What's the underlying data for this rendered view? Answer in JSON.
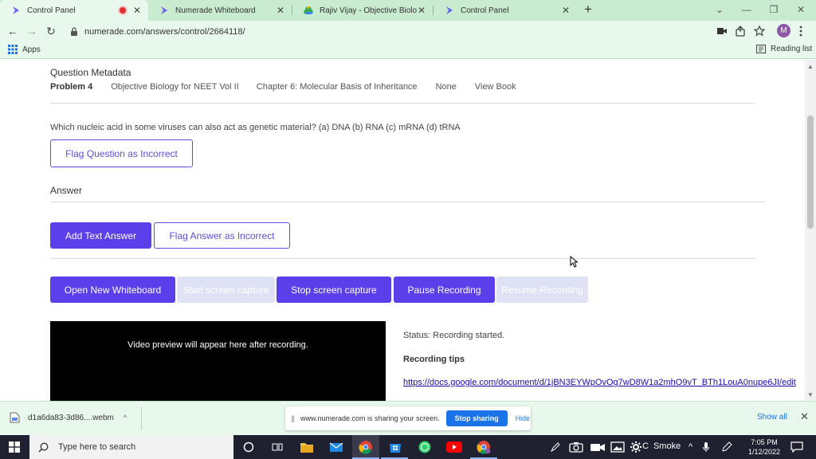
{
  "tabs": [
    {
      "title": "Control Panel",
      "recording": true,
      "active": true
    },
    {
      "title": "Numerade Whiteboard",
      "active": false
    },
    {
      "title": "Rajiv Vijay - Objective Biology fo",
      "active": false
    },
    {
      "title": "Control Panel",
      "active": false
    }
  ],
  "toolbar": {
    "url": "numerade.com/answers/control/2664118/",
    "avatar_letter": "M"
  },
  "bookmarks": {
    "apps_label": "Apps",
    "reading_list_label": "Reading list"
  },
  "page": {
    "metadata_title": "Question Metadata",
    "problem": "Problem 4",
    "book": "Objective Biology for NEET Vol II",
    "chapter": "Chapter 6: Molecular Basis of Inheritance",
    "section": "None",
    "view_book": "View Book",
    "question": "Which nucleic acid in some viruses can also act as genetic material? (a) DNA (b) RNA (c) mRNA (d) tRNA",
    "flag_question": "Flag Question as Incorrect",
    "answer_title": "Answer",
    "add_text_answer": "Add Text Answer",
    "flag_answer": "Flag Answer as Incorrect",
    "open_whiteboard": "Open New Whiteboard",
    "start_capture": "Start screen capture",
    "stop_capture": "Stop screen capture",
    "pause_recording": "Pause Recording",
    "resume_recording": "Resume Recording",
    "video_placeholder": "Video preview will appear here after recording.",
    "status": "Status: Recording started.",
    "recording_tips": "Recording tips",
    "tips_link": "https://docs.google.com/document/d/1jBN3EYWpOvOg7wD8W1a2mhO9vT_BTh1LouA0nupe6JI/edit"
  },
  "download": {
    "filename": "d1a6da83-3d86....webm",
    "show_all": "Show all"
  },
  "share": {
    "message": "www.numerade.com is sharing your screen.",
    "stop_label": "Stop sharing",
    "hide_label": "Hide"
  },
  "taskbar": {
    "search_placeholder": "Type here to search",
    "weather": "Smoke",
    "time": "7:05 PM",
    "date": "1/12/2022"
  },
  "colors": {
    "primary": "#5a3fea",
    "chrome_theme": "#c9ebcf",
    "taskbar": "#1f2030",
    "share_blue": "#1a73e8"
  }
}
